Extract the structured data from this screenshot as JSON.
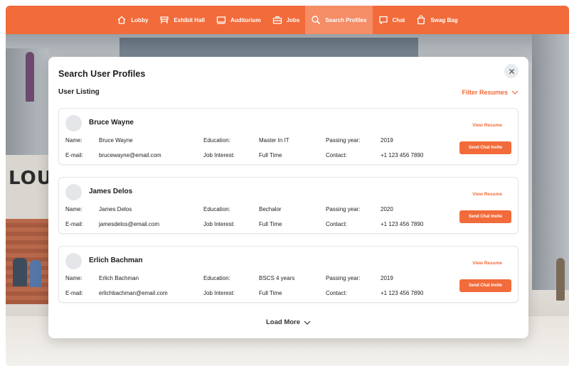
{
  "nav": {
    "items": [
      {
        "label": "Lobby",
        "icon": "home-icon"
      },
      {
        "label": "Exhibit Hall",
        "icon": "booth-icon"
      },
      {
        "label": "Auditorium",
        "icon": "screen-icon"
      },
      {
        "label": "Jobs",
        "icon": "briefcase-icon"
      },
      {
        "label": "Search Profiles",
        "icon": "search-icon"
      },
      {
        "label": "Chat",
        "icon": "chat-icon"
      },
      {
        "label": "Swag Bag",
        "icon": "bag-icon"
      }
    ],
    "active": "Search Profiles",
    "background_color": "#f26b3a"
  },
  "scene": {
    "sign_text": "LOUN"
  },
  "modal": {
    "title": "Search User Profiles",
    "listing_label": "User Listing",
    "filter_label": "Filter Resumes",
    "load_more_label": "Load More",
    "labels": {
      "name": "Name:",
      "email": "E-mail:",
      "education": "Education:",
      "job_interest": "Job Interest:",
      "passing_year": "Passing year:",
      "contact": "Contact:"
    },
    "view_resume_label": "View Resume",
    "send_invite_label": "Send Chat Invite",
    "profiles": [
      {
        "display_name": "Bruce Wayne",
        "name": "Bruce Wayne",
        "email": "brucewayne@email.com",
        "education": "Master In IT",
        "job_interest": "Full Time",
        "passing_year": "2019",
        "contact": "+1 123 456 7890"
      },
      {
        "display_name": "James Delos",
        "name": "James Delos",
        "email": "jamesdelos@email.com",
        "education": "Bechalor",
        "job_interest": "Full Time",
        "passing_year": "2020",
        "contact": "+1 123 456 7890"
      },
      {
        "display_name": "Erlich Bachman",
        "name": "Erlich Bachman",
        "email": "erlichbachman@email.com",
        "education": "BSCS 4 years",
        "job_interest": "Full Time",
        "passing_year": "2019",
        "contact": "+1 123 456 7890"
      }
    ]
  },
  "colors": {
    "accent": "#f26b3a",
    "active_nav": "#f58d66"
  }
}
